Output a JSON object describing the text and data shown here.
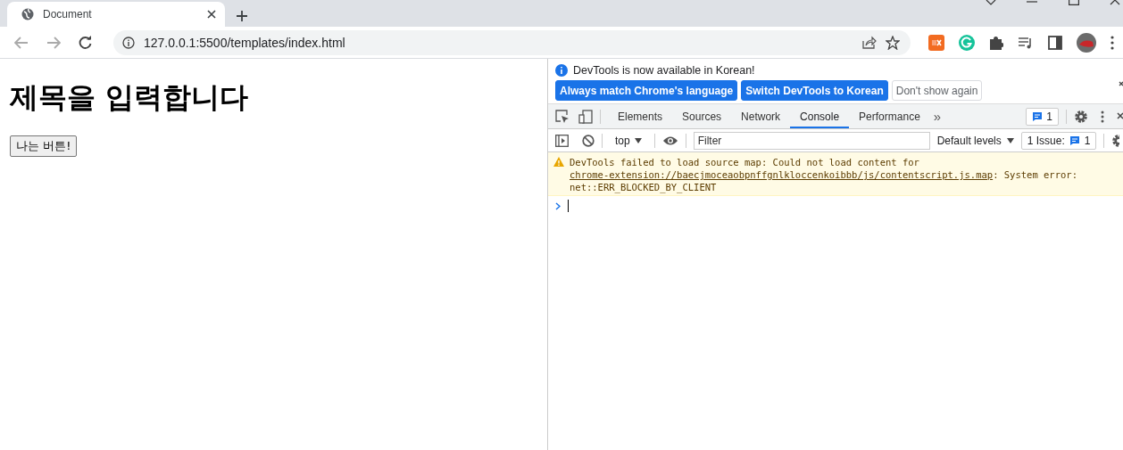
{
  "browser_tab": {
    "title": "Document",
    "selected": true
  },
  "address_bar": {
    "url": "127.0.0.1:5500/templates/index.html"
  },
  "page": {
    "heading": "제목을 입력합니다",
    "button": "나는 버튼!"
  },
  "devtools": {
    "infobar": {
      "message": "DevTools is now available in Korean!",
      "buttons": [
        {
          "label": "Always match Chrome's language",
          "kind": "primary"
        },
        {
          "label": "Switch DevTools to Korean",
          "kind": "primary"
        },
        {
          "label": "Don't show again",
          "kind": "secondary"
        }
      ]
    },
    "tabs": [
      {
        "label": "Elements",
        "selected": false
      },
      {
        "label": "Sources",
        "selected": false
      },
      {
        "label": "Network",
        "selected": false
      },
      {
        "label": "Console",
        "selected": true
      },
      {
        "label": "Performance",
        "selected": false
      }
    ],
    "overflow": "»",
    "issues_badge": "1",
    "console_toolbar": {
      "context": "top",
      "filter_placeholder": "Filter",
      "levels": "Default levels",
      "issues_label": "1 Issue:",
      "issues_count": "1"
    },
    "messages": [
      {
        "kind": "warning",
        "text": "DevTools failed to load source map: Could not load content for ",
        "link": "chrome-extension://baecjmoceaobpnffgnlkloccenkoibbb/js/contentscript.js.map",
        "suffix": ": System error: net::ERR_BLOCKED_BY_CLIENT"
      }
    ]
  }
}
